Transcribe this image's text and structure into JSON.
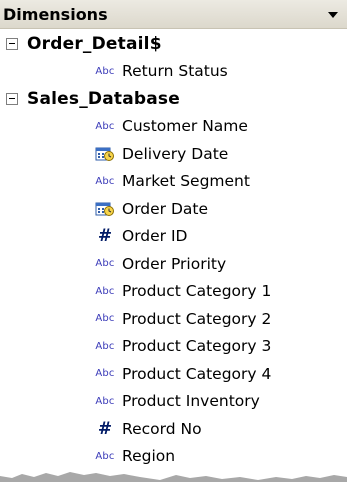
{
  "panel": {
    "title": "Dimensions",
    "dropdown_icon": "triangle-down-icon"
  },
  "groups": [
    {
      "name": "Order_Detail$",
      "expanded": true,
      "fields": [
        {
          "label": "Return Status",
          "type": "string",
          "icon": "abc-icon"
        }
      ]
    },
    {
      "name": "Sales_Database",
      "expanded": true,
      "fields": [
        {
          "label": "Customer Name",
          "type": "string",
          "icon": "abc-icon"
        },
        {
          "label": "Delivery Date",
          "type": "date",
          "icon": "calendar-icon"
        },
        {
          "label": "Market Segment",
          "type": "string",
          "icon": "abc-icon"
        },
        {
          "label": "Order Date",
          "type": "date",
          "icon": "calendar-icon"
        },
        {
          "label": "Order ID",
          "type": "number",
          "icon": "hash-icon"
        },
        {
          "label": "Order Priority",
          "type": "string",
          "icon": "abc-icon"
        },
        {
          "label": "Product Category 1",
          "type": "string",
          "icon": "abc-icon"
        },
        {
          "label": "Product Category 2",
          "type": "string",
          "icon": "abc-icon"
        },
        {
          "label": "Product Category 3",
          "type": "string",
          "icon": "abc-icon"
        },
        {
          "label": "Product Category 4",
          "type": "string",
          "icon": "abc-icon"
        },
        {
          "label": "Product Inventory",
          "type": "string",
          "icon": "abc-icon"
        },
        {
          "label": "Record No",
          "type": "number",
          "icon": "hash-icon"
        },
        {
          "label": "Region",
          "type": "string",
          "icon": "abc-icon"
        }
      ]
    }
  ],
  "icon_glyphs": {
    "abc": "Abc",
    "hash": "#"
  },
  "colors": {
    "header_bg": "#dcd8cc",
    "abc_icon": "#3a3ab8",
    "hash_icon": "#001a66",
    "calendar_icon": "#3b6fc4"
  }
}
